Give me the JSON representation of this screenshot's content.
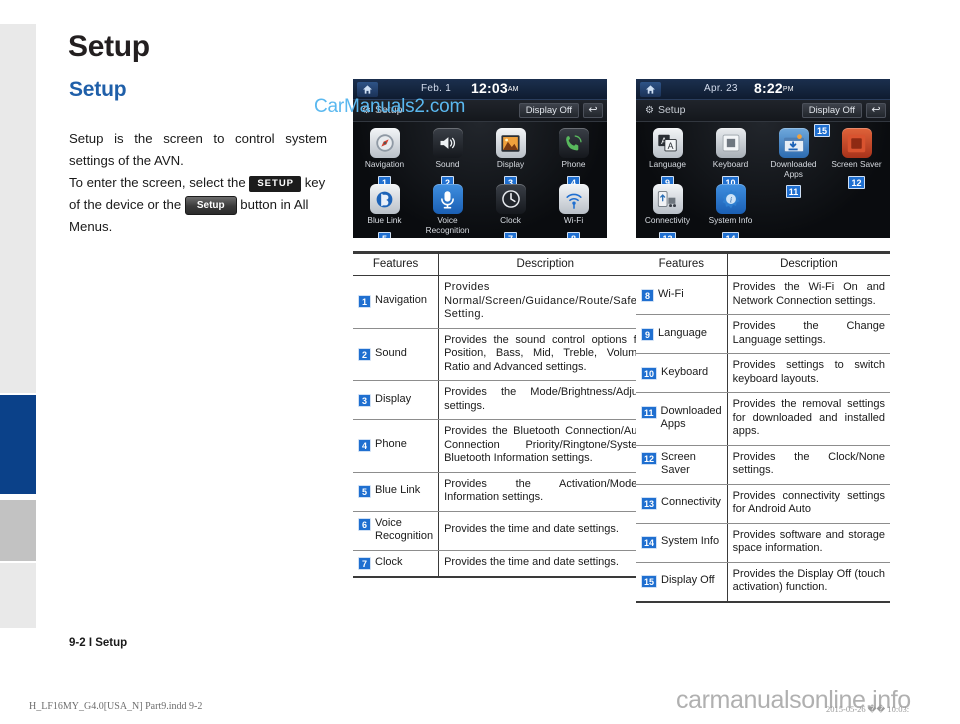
{
  "page": {
    "title": "Setup",
    "section_heading": "Setup",
    "body_parts": {
      "p1": "Setup is the screen to control system settings of the AVN.",
      "p2_before": "To enter the screen, select the",
      "hard_key_label": "SETUP",
      "p2_middle": "key of the device or the",
      "soft_key_label": "Setup",
      "p2_after": "button in All Menus."
    },
    "page_footer": "9-2 I Setup",
    "print_footer": "H_LF16MY_G4.0[USA_N] Part9.indd   9-2",
    "print_date": "2015-05-26   �� 10:03:",
    "brand_watermark": "carmanualsonline.info",
    "overlay_watermark": "CarManuals2.com"
  },
  "screens": [
    {
      "name": "setup-screen-page-1",
      "status": {
        "date": "Feb.  1",
        "time": "12:03",
        "ampm": "AM"
      },
      "titlebar": {
        "title": "Setup",
        "display_off": "Display Off",
        "back": "↩"
      },
      "items": [
        {
          "badge": "1",
          "label": "Navigation",
          "icon": "compass-icon",
          "icon_class": "ic-nav"
        },
        {
          "badge": "2",
          "label": "Sound",
          "icon": "speaker-icon",
          "icon_class": "ic-sound"
        },
        {
          "badge": "3",
          "label": "Display",
          "icon": "picture-icon",
          "icon_class": "ic-disp"
        },
        {
          "badge": "4",
          "label": "Phone",
          "icon": "phone-icon",
          "icon_class": "ic-phone"
        },
        {
          "badge": "5",
          "label": "Blue Link",
          "icon": "bluelink-icon",
          "icon_class": "ic-blue"
        },
        {
          "badge": "6",
          "label": "Voice\nRecognition",
          "icon": "microphone-icon",
          "icon_class": "ic-voice"
        },
        {
          "badge": "7",
          "label": "Clock",
          "icon": "clock-icon",
          "icon_class": "ic-clock"
        },
        {
          "badge": "8",
          "label": "Wi-Fi",
          "icon": "wifi-icon",
          "icon_class": "ic-wifi"
        }
      ]
    },
    {
      "name": "setup-screen-page-2",
      "status": {
        "date": "Apr. 23",
        "time": "8:22",
        "ampm": "PM"
      },
      "titlebar": {
        "title": "Setup",
        "display_off": "Display Off",
        "back": "↩",
        "display_off_badge": "15"
      },
      "items": [
        {
          "badge": "9",
          "label": "Language",
          "icon": "language-icon",
          "icon_class": "ic-lang"
        },
        {
          "badge": "10",
          "label": "Keyboard",
          "icon": "keyboard-icon",
          "icon_class": "ic-kbd"
        },
        {
          "badge": "11",
          "label": "Downloaded\nApps",
          "icon": "download-apps-icon",
          "icon_class": "ic-dapp"
        },
        {
          "badge": "12",
          "label": "Screen Saver",
          "icon": "screen-saver-icon",
          "icon_class": "ic-saver"
        },
        {
          "badge": "13",
          "label": "Connectivity",
          "icon": "connectivity-icon",
          "icon_class": "ic-conn"
        },
        {
          "badge": "14",
          "label": "System Info",
          "icon": "system-info-icon",
          "icon_class": "ic-sysin"
        }
      ]
    }
  ],
  "tables": [
    {
      "name": "features-table-left",
      "headers": {
        "features": "Features",
        "description": "Description"
      },
      "rows": [
        {
          "badge": "1",
          "feature": "Navigation",
          "description": "Provides Normal/Screen/Guidance/Route/Safety Setting.",
          "spaced": true
        },
        {
          "badge": "2",
          "feature": "Sound",
          "description": "Provides the sound control options for Position, Bass, Mid, Treble, Volume, Ratio and Advanced settings.",
          "spaced": false
        },
        {
          "badge": "3",
          "feature": "Display",
          "description": "Provides the Mode/Brightness/Adjust settings.",
          "spaced": false
        },
        {
          "badge": "4",
          "feature": "Phone",
          "description": "Provides the Bluetooth Connection/Auto Connection Priority/Ringtone/System Bluetooth Information settings.",
          "spaced": false
        },
        {
          "badge": "5",
          "feature": "Blue Link",
          "description": "Provides the Activation/Modem Information settings.",
          "spaced": false
        },
        {
          "badge": "6",
          "feature": "Voice Recognition",
          "description": "Provides the time and date settings.",
          "spaced": false
        },
        {
          "badge": "7",
          "feature": "Clock",
          "description": "Provides the time and date settings.",
          "spaced": false
        }
      ]
    },
    {
      "name": "features-table-right",
      "headers": {
        "features": "Features",
        "description": "Description"
      },
      "rows": [
        {
          "badge": "8",
          "feature": "Wi-Fi",
          "description": "Provides the Wi-Fi On and Network Connection settings.",
          "spaced": false
        },
        {
          "badge": "9",
          "feature": "Language",
          "description": "Provides the Change Language settings.",
          "spaced": false
        },
        {
          "badge": "10",
          "feature": "Keyboard",
          "description": "Provides settings to switch keyboard layouts.",
          "spaced": false
        },
        {
          "badge": "11",
          "feature": "Downloaded Apps",
          "description": "Provides the removal settings for downloaded and installed apps.",
          "spaced": false
        },
        {
          "badge": "12",
          "feature": "Screen Saver",
          "description": "Provides the Clock/None settings.",
          "spaced": false
        },
        {
          "badge": "13",
          "feature": "Connectivity",
          "description": "Provides connectivity settings for Android Auto",
          "spaced": false
        },
        {
          "badge": "14",
          "feature": "System Info",
          "description": "Provides software and storage space information.",
          "spaced": false
        },
        {
          "badge": "15",
          "feature": "Display Off",
          "description": "Provides the Display Off (touch activation) function.",
          "spaced": false
        }
      ]
    }
  ],
  "colors": {
    "heading_blue": "#1f5fa9",
    "tab_blue": "#0b4189",
    "badge_blue": "#1f6fd0",
    "watermark_blue": "#5ab8ef"
  }
}
